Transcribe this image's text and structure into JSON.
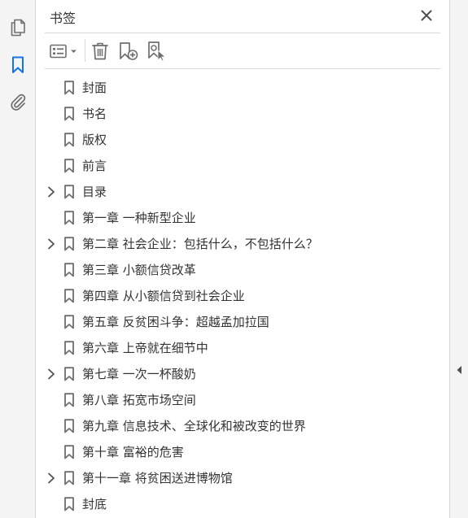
{
  "panel": {
    "title": "书签"
  },
  "rail": {
    "items": [
      {
        "icon": "pages-icon",
        "active": false
      },
      {
        "icon": "bookmark-icon",
        "active": true
      },
      {
        "icon": "attachment-icon",
        "active": false
      }
    ]
  },
  "toolbar": {
    "buttons": [
      "options-menu-icon",
      "delete-icon",
      "new-bookmark-icon",
      "bookmark-from-selection-icon"
    ]
  },
  "colors": {
    "accent": "#1473e6",
    "icon_gray": "#6e6e6e",
    "text": "#333333",
    "divider": "#d9d9d9"
  },
  "bookmarks": [
    {
      "label": "封面",
      "expandable": false
    },
    {
      "label": "书名",
      "expandable": false
    },
    {
      "label": "版权",
      "expandable": false
    },
    {
      "label": "前言",
      "expandable": false
    },
    {
      "label": "目录",
      "expandable": true
    },
    {
      "label": "第一章 一种新型企业",
      "expandable": false
    },
    {
      "label": "第二章 社会企业：包括什么，不包括什么？",
      "expandable": true
    },
    {
      "label": "第三章 小额信贷改革",
      "expandable": false
    },
    {
      "label": "第四章 从小额信贷到社会企业",
      "expandable": false
    },
    {
      "label": "第五章 反贫困斗争：超越孟加拉国",
      "expandable": false
    },
    {
      "label": "第六章 上帝就在细节中",
      "expandable": false
    },
    {
      "label": "第七章 一次一杯酸奶",
      "expandable": true
    },
    {
      "label": "第八章 拓宽市场空间",
      "expandable": false
    },
    {
      "label": "第九章 信息技术、全球化和被改变的世界",
      "expandable": false
    },
    {
      "label": "第十章 富裕的危害",
      "expandable": false
    },
    {
      "label": "第十一章 将贫困送进博物馆",
      "expandable": true
    },
    {
      "label": "封底",
      "expandable": false
    }
  ]
}
